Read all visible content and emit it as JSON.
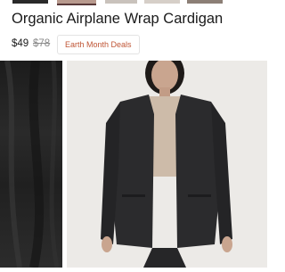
{
  "product": {
    "title": "Organic Airplane Wrap Cardigan",
    "price": "$49",
    "original_price": "$78",
    "deal_label": "Earth Month Deals"
  },
  "colors": {
    "deal_accent": "#c05636",
    "cardigan": "#2b2b2d",
    "background": "#eceae7"
  },
  "icons": {
    "thumbnails": "product-thumbnail-images"
  }
}
